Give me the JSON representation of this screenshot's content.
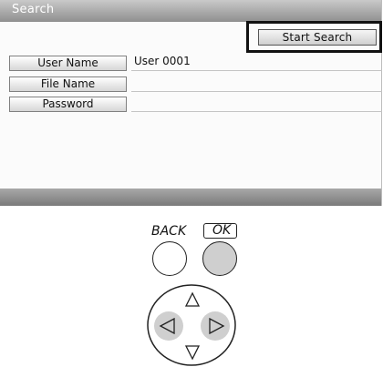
{
  "screen": {
    "title": "Search",
    "start_search_label": "Start Search",
    "fields": [
      {
        "label": "User Name",
        "value": "User 0001"
      },
      {
        "label": "File Name",
        "value": ""
      },
      {
        "label": "Password",
        "value": ""
      }
    ]
  },
  "controls": {
    "back_label": "BACK",
    "ok_label": "OK",
    "up_arrow": "up-arrow",
    "down_arrow": "down-arrow",
    "left_arrow": "left-arrow",
    "right_arrow": "right-arrow",
    "highlight_color": "#cfcfcf"
  }
}
